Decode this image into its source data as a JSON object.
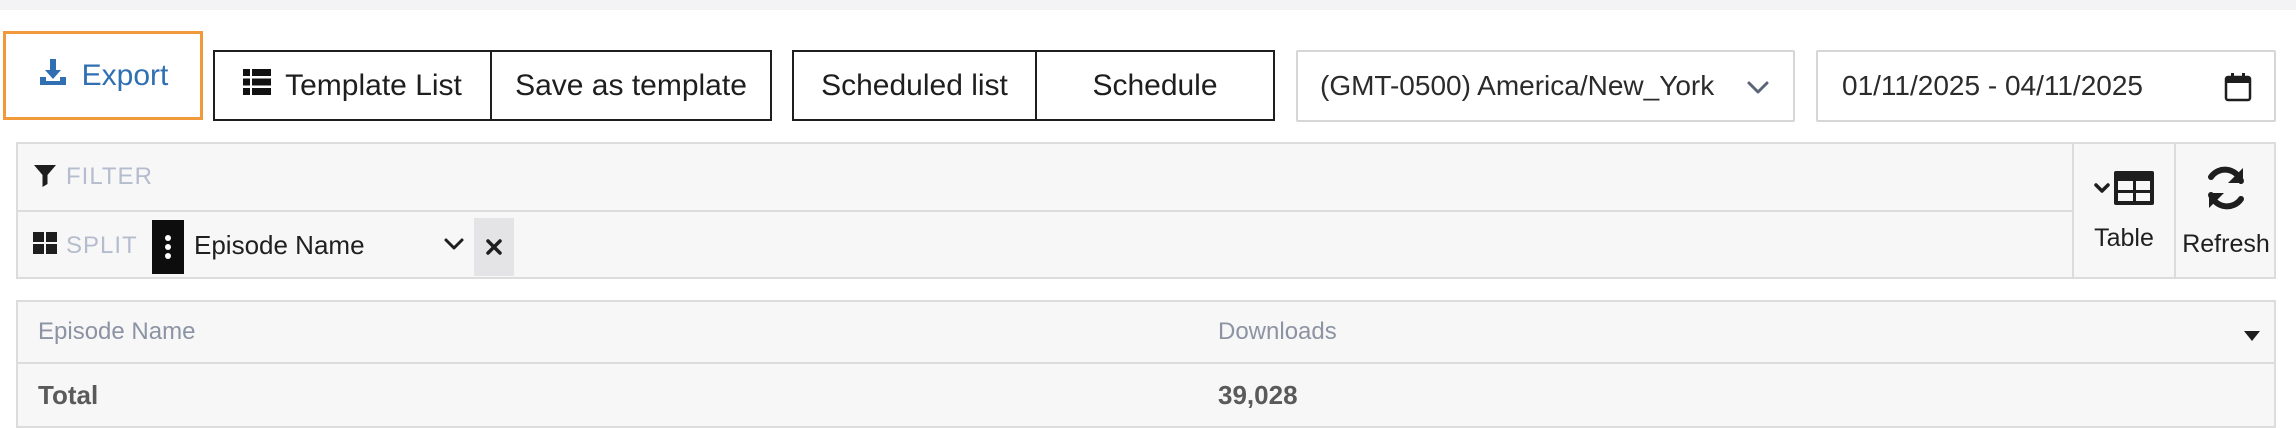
{
  "toolbar": {
    "export_label": "Export",
    "template_list_label": "Template List",
    "save_template_label": "Save as template",
    "scheduled_list_label": "Scheduled list",
    "schedule_label": "Schedule",
    "timezone_value": "(GMT-0500) America/New_York",
    "date_range_value": "01/11/2025 - 04/11/2025"
  },
  "panel": {
    "filter_label": "FILTER",
    "split_label": "SPLIT",
    "split_chip_label": "Episode Name",
    "table_button_label": "Table",
    "refresh_button_label": "Refresh"
  },
  "table": {
    "columns": [
      "Episode Name",
      "Downloads"
    ],
    "rows": [
      {
        "episode_name": "Total",
        "downloads": "39,028"
      }
    ]
  },
  "colors": {
    "export_accent": "#2f6fb2",
    "export_focus_border": "#f09a3c",
    "muted_text": "#b5bccd",
    "header_text": "#8c93a3"
  },
  "icons": {
    "export": "download-icon",
    "template_list": "list-icon",
    "timezone": "chevron-down-icon",
    "date": "calendar-icon",
    "filter": "filter-icon",
    "split": "grid-icon",
    "chip_handle": "drag-handle-icon",
    "chip_dropdown": "chevron-down-icon",
    "chip_remove": "close-icon",
    "table": "table-icon",
    "refresh": "refresh-icon",
    "column_menu": "caret-down-icon"
  }
}
